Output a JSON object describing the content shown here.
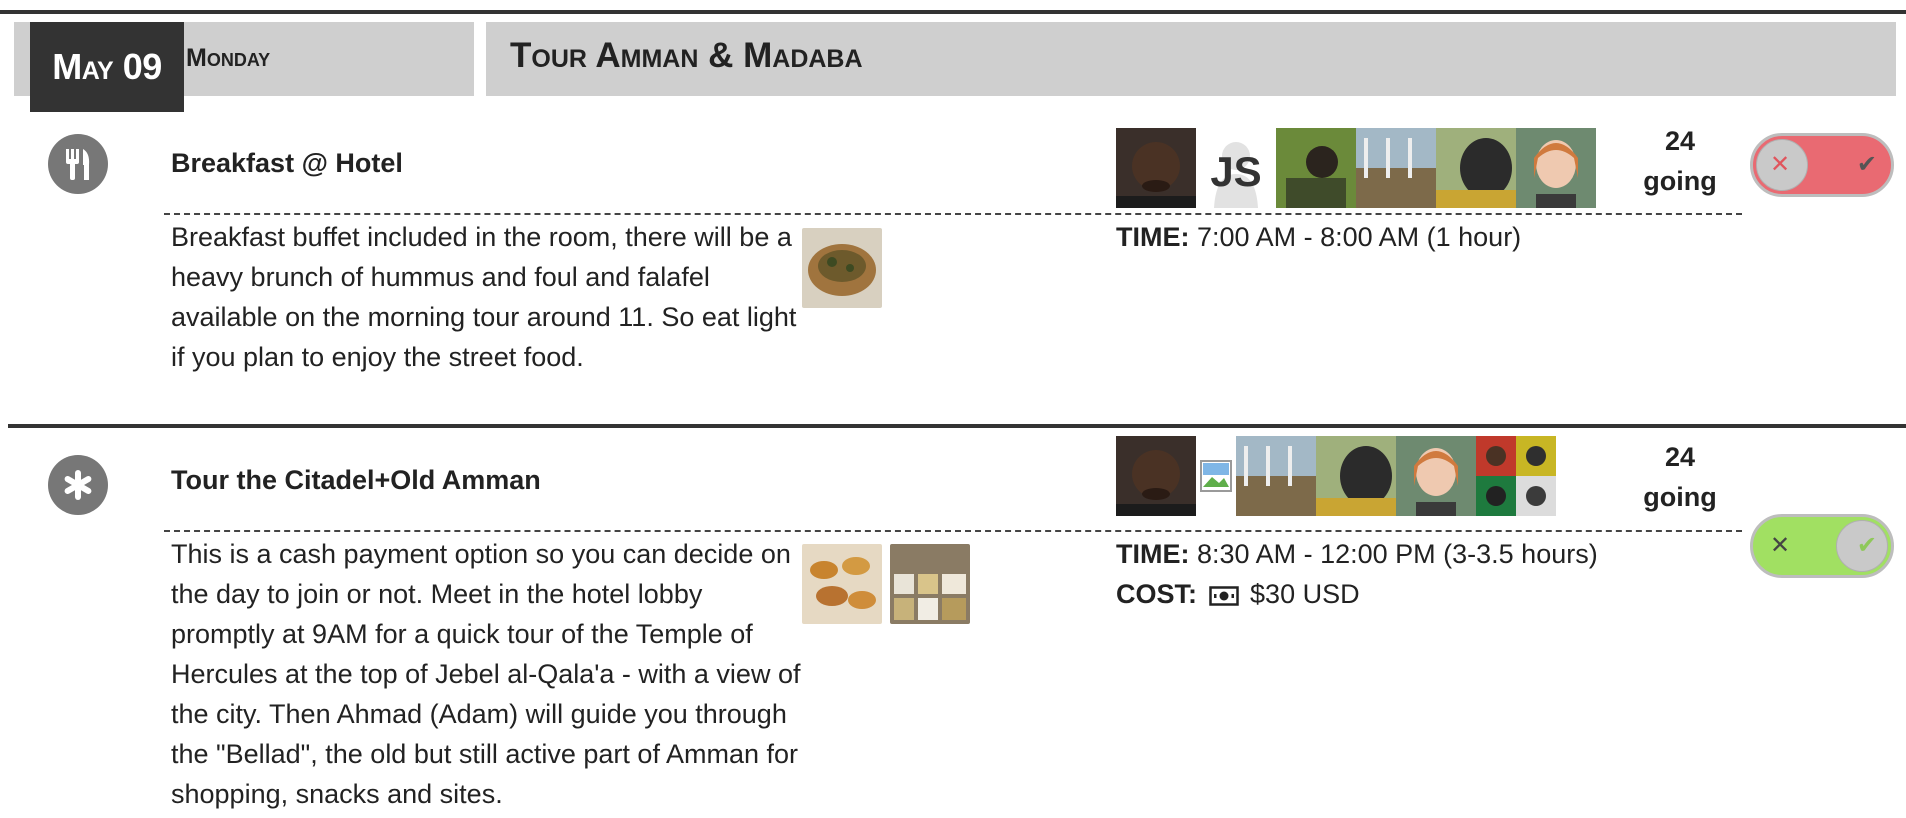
{
  "header": {
    "date": "May 09",
    "day": "Monday",
    "title": "Tour Amman & Madaba"
  },
  "events": [
    {
      "title": "Breakfast @ Hotel",
      "icon": "utensils-icon",
      "description": "Breakfast buffet included in the room, there will be a heavy brunch of hummus and foul and falafel available on the morning tour around 11. So eat light if you plan to enjoy the street food.",
      "time_label": "TIME:",
      "time_value": "7:00 AM - 8:00 AM (1 hour)",
      "attendee_initials": "JS",
      "going_count": "24",
      "going_label": "going",
      "rsvp_state": "not-going",
      "toggle_x": "✕",
      "toggle_check": "✔"
    },
    {
      "title": "Tour the Citadel+Old Amman",
      "icon": "asterisk-icon",
      "description": "This is a cash payment option so you can decide on the day to join or not. Meet in the hotel lobby promptly at 9AM for a quick tour of the Temple of Hercules at the top of Jebel al-Qala'a - with a view of the city. Then Ahmad (Adam) will guide you through the \"Bellad\", the old but still active part of Amman for shopping, snacks and sites.",
      "time_label": "TIME:",
      "time_value": "8:30 AM - 12:00 PM (3-3.5 hours)",
      "cost_label": "COST:",
      "cost_value": "$30 USD",
      "going_count": "24",
      "going_label": "going",
      "rsvp_state": "going",
      "toggle_x": "✕",
      "toggle_check": "✔"
    }
  ],
  "colors": {
    "header_bar": "#cfcfcf",
    "date_box": "#333333",
    "toggle_off": "#e96a72",
    "toggle_on": "#a1e062"
  }
}
